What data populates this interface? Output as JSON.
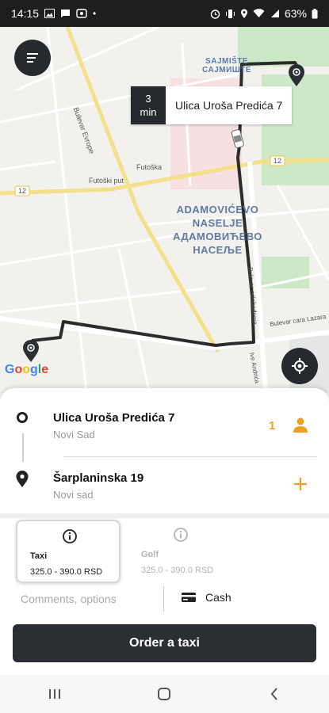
{
  "status_bar": {
    "time": "14:15",
    "battery": "63%",
    "left_icons": [
      "image-icon",
      "message-icon",
      "voicemail-icon",
      "dot-icon"
    ],
    "right_icons": [
      "alarm-icon",
      "vibrate-icon",
      "location-icon",
      "wifi-icon",
      "signal-icon",
      "battery-icon"
    ]
  },
  "map": {
    "labels": {
      "sajmiste_lat": "SAJMIŠTE",
      "sajmiste_cyr": "САЈМИШТЕ",
      "adamovicevo_lat_1": "ADAMOVIĆEVO",
      "adamovicevo_lat_2": "NASELJE",
      "adamovicevo_cyr_1": "АДАМОВИЋЕВО",
      "adamovicevo_cyr_2": "НАСЕЉЕ",
      "road_12_right": "12",
      "road_12_left": "12",
      "bulevar_evrope": "Bulevar Evrope",
      "futoski_put": "Futoški put",
      "futoska": "Futoška",
      "bulevar_cara_lazara": "Bulevar cara Lazara",
      "rumenacka": "Bulevar oslobođenja",
      "ive_andrica": "Ive Andrića"
    },
    "google": [
      "G",
      "o",
      "o",
      "g",
      "l",
      "e"
    ],
    "google_colors": [
      "#4285F4",
      "#EA4335",
      "#FBBC05",
      "#4285F4",
      "#34A853",
      "#EA4335"
    ],
    "eta": {
      "minutes": "3",
      "unit": "min",
      "address": "Ulica Uroša Predića 7"
    }
  },
  "route": {
    "pickup": {
      "title": "Ulica Uroša Predića 7",
      "city": "Novi Sad"
    },
    "destination": {
      "title": "Šarplaninska 19",
      "city": "Novi sad"
    },
    "passengers": "1"
  },
  "tariffs": [
    {
      "name": "Taxi",
      "price": "325.0 - 390.0 RSD",
      "selected": true
    },
    {
      "name": "Golf",
      "price": "325.0 - 390.0 RSD",
      "selected": false
    }
  ],
  "comments_placeholder": "Comments, options",
  "payment": {
    "label": "Cash"
  },
  "order_button": "Order a taxi",
  "colors": {
    "accent": "#F0A020",
    "dark": "#2B2F33",
    "route_line": "#2B2B2B"
  }
}
